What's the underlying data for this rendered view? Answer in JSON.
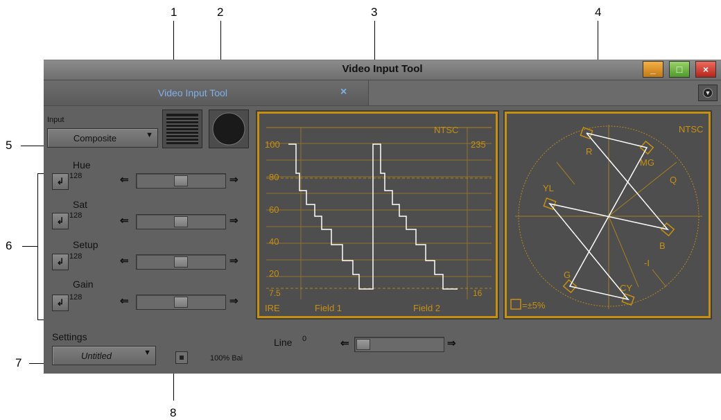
{
  "callouts": {
    "c1": "1",
    "c2": "2",
    "c3": "3",
    "c4": "4",
    "c5": "5",
    "c6": "6",
    "c7": "7",
    "c8": "8"
  },
  "window": {
    "title": "Video Input Tool",
    "min_glyph": "_",
    "max_glyph": "□",
    "close_glyph": "×"
  },
  "tab": {
    "label": "Video Input Tool",
    "close_glyph": "×"
  },
  "input": {
    "label": "Input",
    "value": "Composite",
    "arrow": "▼"
  },
  "controls": [
    {
      "name": "Hue",
      "value": "128",
      "level": 0.5
    },
    {
      "name": "Sat",
      "value": "128",
      "level": 0.5
    },
    {
      "name": "Setup",
      "value": "128",
      "level": 0.5
    },
    {
      "name": "Gain",
      "value": "128",
      "level": 0.5
    }
  ],
  "stepper_glyph": "↲",
  "left_arrow": "⇐",
  "right_arrow": "⇒",
  "settings": {
    "label": "Settings",
    "value": "Untitled",
    "arrow": "▼"
  },
  "bars": {
    "label": "100% Bai"
  },
  "line": {
    "label": "Line",
    "value": "0",
    "level": 0.0
  },
  "waveform": {
    "standard": "NTSC",
    "ire_labels": [
      "100",
      "80",
      "60",
      "40",
      "20",
      "7.5"
    ],
    "right_labels": [
      "235",
      "16"
    ],
    "footer": {
      "unit": "IRE",
      "field1": "Field 1",
      "field2": "Field 2"
    }
  },
  "vectorscope": {
    "standard": "NTSC",
    "targets": [
      "R",
      "MG",
      "YL",
      "Q",
      "B",
      "-I",
      "G",
      "CY"
    ],
    "tolerance": "=±5%"
  },
  "colors": {
    "scope_border": "#c8900f",
    "trace": "#ffffff",
    "tab_text": "#7fb0ea"
  }
}
